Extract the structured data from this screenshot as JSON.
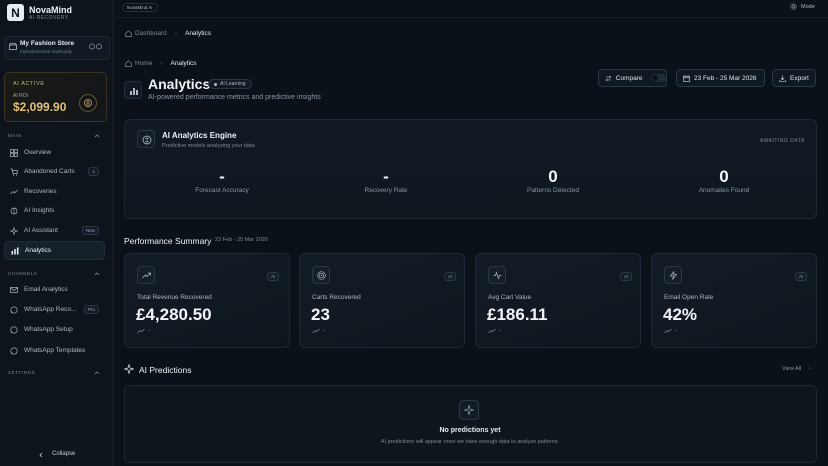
{
  "brand": {
    "logo_letter": "N",
    "name": "NovaMind",
    "subtitle": "AI RECOVERY"
  },
  "store": {
    "name": "My Fashion Store",
    "url": "myfashionstore.myshopify"
  },
  "ai_card": {
    "status": "AI ACTIVE",
    "roi_label": "AI ROI",
    "roi_value": "$2,099.90"
  },
  "sidebar": {
    "main_label": "MAIN",
    "main_items": [
      {
        "label": "Overview",
        "icon": "grid-icon"
      },
      {
        "label": "Abandoned Carts",
        "icon": "cart-icon",
        "badge": "1"
      },
      {
        "label": "Recoveries",
        "icon": "trend-icon"
      },
      {
        "label": "AI Insights",
        "icon": "brain-icon"
      },
      {
        "label": "AI Assistant",
        "icon": "sparkle-icon",
        "badge": "New"
      },
      {
        "label": "Analytics",
        "icon": "chart-icon",
        "active": true
      }
    ],
    "channels_label": "CHANNELS",
    "channel_items": [
      {
        "label": "Email Analytics",
        "icon": "mail-icon"
      },
      {
        "label": "WhatsApp Reco...",
        "icon": "whatsapp-icon",
        "badge": "Pro"
      },
      {
        "label": "WhatsApp Setup",
        "icon": "whatsapp-icon"
      },
      {
        "label": "WhatsApp Templates",
        "icon": "whatsapp-icon"
      }
    ],
    "settings_label": "SETTINGS",
    "collapse_label": "Collapse"
  },
  "topbar": {
    "chip": "NovaMind AI",
    "mode_label": "Mode"
  },
  "breadcrumb_top": {
    "home": "Dashboard",
    "current": "Analytics"
  },
  "breadcrumb_page": {
    "home": "Home",
    "current": "Analytics"
  },
  "page": {
    "title": "Analytics",
    "learning_chip": "AI Learning",
    "subtitle": "AI-powered performance metrics and predictive insights"
  },
  "actions": {
    "compare": "Compare",
    "date_range": "23 Feb - 25 Mar 2026",
    "export": "Export"
  },
  "engine": {
    "title": "AI Analytics Engine",
    "subtitle": "Predictive models analyzing your data",
    "status": "AWAITING DATA",
    "metrics": [
      {
        "value": "-",
        "label": "Forecast Accuracy"
      },
      {
        "value": "-",
        "label": "Recovery Rate"
      },
      {
        "value": "0",
        "label": "Patterns Detected"
      },
      {
        "value": "0",
        "label": "Anomalies Found"
      }
    ]
  },
  "performance": {
    "title": "Performance Summary",
    "date": "23 Feb - 25 Mar 2026",
    "cards": [
      {
        "label": "Total Revenue Recovered",
        "value": "£4,280.50",
        "badge": "AI",
        "trend": "-",
        "icon": "trend-icon"
      },
      {
        "label": "Carts Recovered",
        "value": "23",
        "badge": "AI",
        "trend": "-",
        "icon": "target-icon"
      },
      {
        "label": "Avg Cart Value",
        "value": "£186.11",
        "badge": "AI",
        "trend": "-",
        "icon": "pulse-icon"
      },
      {
        "label": "Email Open Rate",
        "value": "42%",
        "badge": "AI",
        "trend": "-",
        "icon": "bolt-icon"
      }
    ]
  },
  "predictions": {
    "title": "AI Predictions",
    "view_all": "View All",
    "empty_title": "No predictions yet",
    "empty_sub": "AI predictions will appear once we have enough data to analyze patterns."
  }
}
